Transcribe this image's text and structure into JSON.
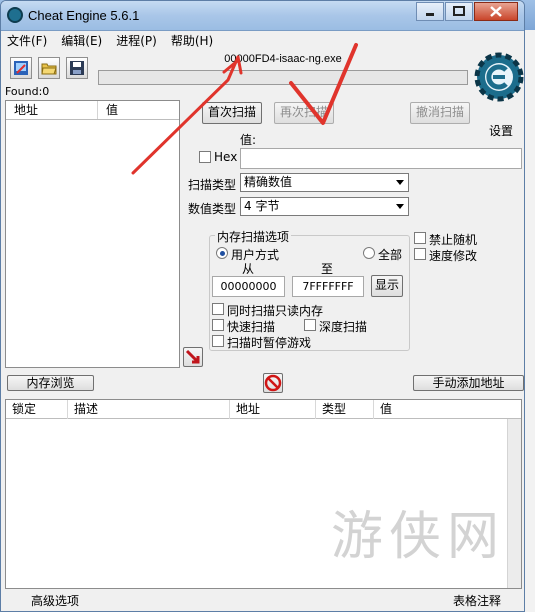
{
  "window": {
    "title": "Cheat Engine 5.6.1",
    "controls": {
      "minimize": "0",
      "maximize": "1",
      "close": "r"
    }
  },
  "menu": [
    "文件(F)",
    "编辑(E)",
    "进程(P)",
    "帮助(H)"
  ],
  "toolbar": {
    "icons": [
      "open-process-icon",
      "open-file-icon",
      "save-icon"
    ]
  },
  "process": {
    "name": "00000FD4-isaac-ng.exe",
    "progress_percent": 0
  },
  "found": "Found:0",
  "logo": {
    "text": "Cheat Engine",
    "settings_label": "设置"
  },
  "results_list": {
    "columns": [
      "地址",
      "值"
    ]
  },
  "scan": {
    "first_scan": "首次扫描",
    "next_scan": "再次扫描",
    "undo_scan": "撤消扫描",
    "value_label": "值:",
    "hex_label": "Hex",
    "value_input": "",
    "scan_type_label": "扫描类型",
    "scan_type_value": "精确数值",
    "value_type_label": "数值类型",
    "value_type_value": "4 字节"
  },
  "memory_options": {
    "title": "内存扫描选项",
    "user_mode": "用户方式",
    "all": "全部",
    "from_label": "从",
    "to_label": "至",
    "from_value": "00000000",
    "to_value": "7FFFFFFF",
    "show_button": "显示",
    "readonly_label": "同时扫描只读内存",
    "fast_scan_label": "快速扫描",
    "deep_scan_label": "深度扫描",
    "pause_label": "扫描时暂停游戏"
  },
  "side_options": {
    "disable_random": "禁止随机",
    "speed_hack": "速度修改"
  },
  "bottom": {
    "memory_view": "内存浏览",
    "add_address": "手动添加地址"
  },
  "address_table": {
    "columns": [
      "锁定",
      "描述",
      "地址",
      "类型",
      "值"
    ]
  },
  "statusbar": {
    "advanced": "高级选项",
    "comments": "表格注释"
  },
  "watermark": "游侠网",
  "colors": {
    "title_bar": "#a9c6e8",
    "annotation_red": "#e0342c",
    "logo_teal": "#1c6d8c",
    "progress_green": "#3c9a3c"
  }
}
